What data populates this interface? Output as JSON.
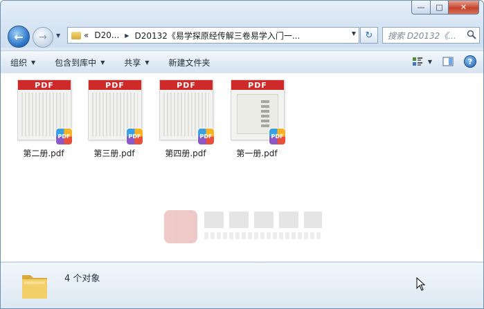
{
  "window": {
    "caption_buttons": {
      "minimize": "—",
      "maximize": "□",
      "close": "✕"
    }
  },
  "address_bar": {
    "crumbs": [
      "D20...",
      "D20132《易学探原经传解三卷易学入门一..."
    ],
    "chevron": "«"
  },
  "search": {
    "placeholder": "搜索 D20132《..."
  },
  "toolbar": {
    "organize": "组织",
    "include_in_library": "包含到库中",
    "share": "共享",
    "new_folder": "新建文件夹"
  },
  "files": [
    {
      "name": "第二册.pdf",
      "badge": "PDF",
      "thumb_band": "PDF"
    },
    {
      "name": "第三册.pdf",
      "badge": "PDF",
      "thumb_band": "PDF"
    },
    {
      "name": "第四册.pdf",
      "badge": "PDF",
      "thumb_band": "PDF"
    },
    {
      "name": "第一册.pdf",
      "badge": "PDF",
      "thumb_band": "PDF"
    }
  ],
  "status": {
    "text": "4 个对象"
  },
  "colors": {
    "pdf_red": "#cf2a2a",
    "frame_blue": "#d6e4f3"
  }
}
